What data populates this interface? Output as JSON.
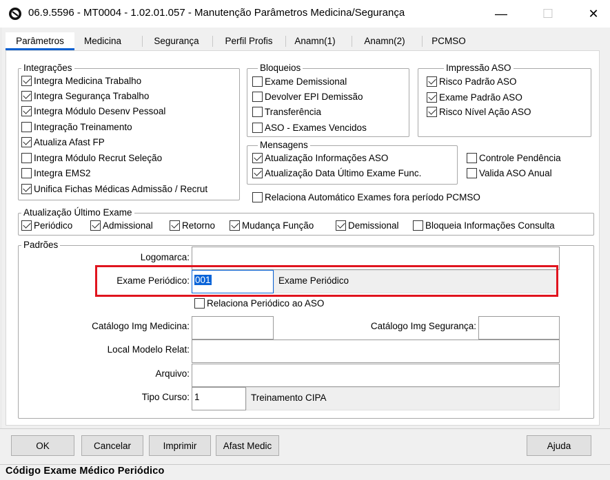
{
  "window": {
    "title": "06.9.5596 - MT0004 - 1.02.01.057 - Manutenção Parâmetros Medicina/Segurança",
    "minimize": "—",
    "maximize": "☐",
    "close": "✕"
  },
  "tabs": [
    {
      "label": "Parâmetros"
    },
    {
      "label": "Medicina"
    },
    {
      "label": "Segurança"
    },
    {
      "label": "Perfil Profis"
    },
    {
      "label": "Anamn(1)"
    },
    {
      "label": "Anamn(2)"
    },
    {
      "label": "PCMSO"
    }
  ],
  "integracoes": {
    "legend": "Integrações",
    "items": [
      {
        "label": "Integra Medicina Trabalho",
        "checked": true
      },
      {
        "label": "Integra Segurança Trabalho",
        "checked": true
      },
      {
        "label": "Integra Módulo Desenv Pessoal",
        "checked": true
      },
      {
        "label": "Integração Treinamento",
        "checked": false
      },
      {
        "label": "Atualiza Afast FP",
        "checked": true
      },
      {
        "label": "Integra Módulo Recrut Seleção",
        "checked": false
      },
      {
        "label": "Integra EMS2",
        "checked": false
      },
      {
        "label": "Unifica Fichas Médicas Admissão / Recrut",
        "checked": true
      }
    ]
  },
  "bloqueios": {
    "legend": "Bloqueios",
    "items": [
      {
        "label": "Exame Demissional",
        "checked": false
      },
      {
        "label": "Devolver EPI Demissão",
        "checked": false
      },
      {
        "label": "Transferência",
        "checked": false
      },
      {
        "label": "ASO - Exames Vencidos",
        "checked": false
      }
    ]
  },
  "impressao": {
    "legend": "Impressão ASO",
    "items": [
      {
        "label": "Risco Padrão ASO",
        "checked": true
      },
      {
        "label": "Exame Padrão ASO",
        "checked": true
      },
      {
        "label": "Risco Nível Ação ASO",
        "checked": true
      }
    ]
  },
  "mensagens": {
    "legend": "Mensagens",
    "items": [
      {
        "label": "Atualização Informações ASO",
        "checked": true
      },
      {
        "label": "Atualização Data Último Exame Func.",
        "checked": true
      }
    ]
  },
  "extras": [
    {
      "label": "Controle Pendência",
      "checked": false
    },
    {
      "label": "Valida ASO Anual",
      "checked": false
    },
    {
      "label": "Relaciona Automático Exames fora período PCMSO",
      "checked": false
    }
  ],
  "ultimo_exame": {
    "legend": "Atualização Último Exame",
    "items": [
      {
        "label": "Periódico",
        "checked": true
      },
      {
        "label": "Admissional",
        "checked": true
      },
      {
        "label": "Retorno",
        "checked": true
      },
      {
        "label": "Mudança Função",
        "checked": true
      },
      {
        "label": "Demissional",
        "checked": true
      },
      {
        "label": "Bloqueia Informações Consulta",
        "checked": false
      }
    ]
  },
  "padroes": {
    "legend": "Padrões",
    "logomarca_label": "Logomarca:",
    "logomarca_value": "",
    "exame_periodico_label": "Exame Periódico:",
    "exame_periodico_value": "001",
    "exame_periodico_desc": "Exame Periódico",
    "relaciona_periodico": {
      "label": "Relaciona Periódico ao ASO",
      "checked": false
    },
    "catalogo_medicina_label": "Catálogo Img Medicina:",
    "catalogo_medicina_value": "",
    "catalogo_seguranca_label": "Catálogo Img Segurança:",
    "catalogo_seguranca_value": "",
    "local_modelo_label": "Local Modelo Relat:",
    "local_modelo_value": "",
    "arquivo_label": "Arquivo:",
    "arquivo_value": "",
    "tipo_curso_label": "Tipo Curso:",
    "tipo_curso_value": "1",
    "tipo_curso_desc": "Treinamento CIPA"
  },
  "buttons": {
    "ok": "OK",
    "cancelar": "Cancelar",
    "imprimir": "Imprimir",
    "afast_medic": "Afast Medic",
    "ajuda": "Ajuda"
  },
  "status": "Código Exame Médico Periódico"
}
